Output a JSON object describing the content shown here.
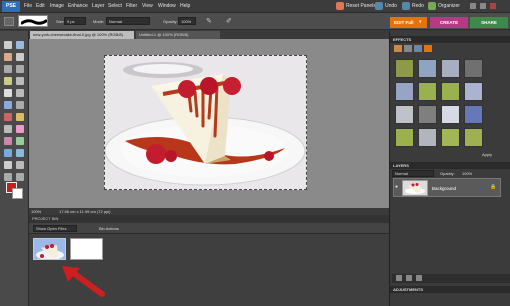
{
  "menubar": {
    "logo": "PSE",
    "items": [
      "File",
      "Edit",
      "Image",
      "Enhance",
      "Layer",
      "Select",
      "Filter",
      "View",
      "Window",
      "Help"
    ],
    "reset_panels": "Reset Panels",
    "undo": "Undo",
    "redo": "Redo",
    "organizer": "Organizer"
  },
  "options": {
    "size_label": "Size:",
    "size_value": "9 px",
    "mode_label": "Mode:",
    "mode_value": "Normal",
    "opacity_label": "Opacity:",
    "opacity_value": "100%"
  },
  "workspace_tabs": {
    "edit_full": "EDIT Full",
    "create": "CREATE",
    "share": "SHARE"
  },
  "document_tabs": [
    {
      "label": "new-york-cheesecake-final-0.jpg @ 100% (RGB/8)"
    },
    {
      "label": "Untitled-1 @ 100% (RGB/8)"
    }
  ],
  "status": {
    "zoom": "100%",
    "doc_size": "17.96 cm x 11.99 cm (72 ppi)"
  },
  "project_bin": {
    "title": "PROJECT BIN",
    "show_label": "Show Open Files",
    "bin_actions": "Bin Actions"
  },
  "effects_panel": {
    "title": "EFFECTS",
    "apply": "Apply"
  },
  "layers_panel": {
    "title": "LAYERS",
    "blend_mode": "Normal",
    "opacity_label": "Opacity:",
    "opacity_value": "100%",
    "layer_name": "Background"
  },
  "adjustments": {
    "title": "ADJUSTMENTS"
  },
  "colors": {
    "accent_orange": "#e5730c",
    "create_purple": "#b53a86",
    "share_green": "#3f8a4a",
    "foreground_color": "#c41f1f",
    "background_color": "#ffffff",
    "annotation_arrow": "#cc1f1f"
  }
}
